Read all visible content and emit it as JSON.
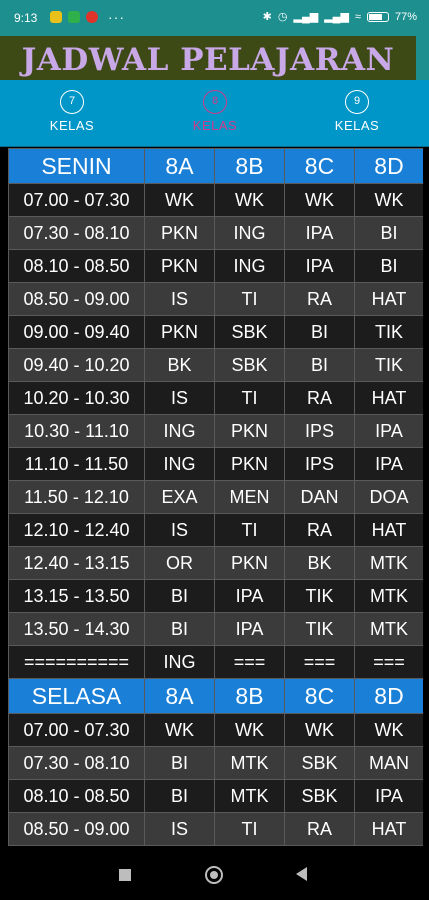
{
  "status": {
    "time": "9:13",
    "battery": "77",
    "battery_level": 0.77,
    "left_icons": [
      "notification-yellow",
      "shield-green",
      "mi-red"
    ],
    "right_icons": [
      "bluetooth-icon",
      "alarm-icon",
      "signal-icon",
      "signal-icon",
      "wifi-icon",
      "battery-icon"
    ]
  },
  "title": "JADWAL PELAJARAN",
  "tabs": [
    {
      "number": "7",
      "label": "KELAS",
      "active": false
    },
    {
      "number": "8",
      "label": "KELAS",
      "active": true
    },
    {
      "number": "9",
      "label": "KELAS",
      "active": false
    }
  ],
  "colors": {
    "accent": "#d23c8c",
    "header": "#1a7fd6",
    "tabbar": "#0096c7",
    "titlebar": "#3d4a16",
    "title_text": "#c9a8e8"
  },
  "days": [
    {
      "name": "SENIN",
      "classes": [
        "8A",
        "8B",
        "8C",
        "8D"
      ],
      "rows": [
        {
          "time": "07.00 - 07.30",
          "cells": [
            "WK",
            "WK",
            "WK",
            "WK"
          ]
        },
        {
          "time": "07.30 - 08.10",
          "cells": [
            "PKN",
            "ING",
            "IPA",
            "BI"
          ]
        },
        {
          "time": "08.10 - 08.50",
          "cells": [
            "PKN",
            "ING",
            "IPA",
            "BI"
          ]
        },
        {
          "time": "08.50 - 09.00",
          "cells": [
            "IS",
            "TI",
            "RA",
            "HAT"
          ]
        },
        {
          "time": "09.00 - 09.40",
          "cells": [
            "PKN",
            "SBK",
            "BI",
            "TIK"
          ]
        },
        {
          "time": "09.40 - 10.20",
          "cells": [
            "BK",
            "SBK",
            "BI",
            "TIK"
          ]
        },
        {
          "time": "10.20 - 10.30",
          "cells": [
            "IS",
            "TI",
            "RA",
            "HAT"
          ]
        },
        {
          "time": "10.30 - 11.10",
          "cells": [
            "ING",
            "PKN",
            "IPS",
            "IPA"
          ]
        },
        {
          "time": "11.10 - 11.50",
          "cells": [
            "ING",
            "PKN",
            "IPS",
            "IPA"
          ]
        },
        {
          "time": "11.50 - 12.10",
          "cells": [
            "EXA",
            "MEN",
            "DAN",
            "DOA"
          ]
        },
        {
          "time": "12.10 - 12.40",
          "cells": [
            "IS",
            "TI",
            "RA",
            "HAT"
          ]
        },
        {
          "time": "12.40 - 13.15",
          "cells": [
            "OR",
            "PKN",
            "BK",
            "MTK"
          ]
        },
        {
          "time": "13.15 - 13.50",
          "cells": [
            "BI",
            "IPA",
            "TIK",
            "MTK"
          ]
        },
        {
          "time": "13.50 - 14.30",
          "cells": [
            "BI",
            "IPA",
            "TIK",
            "MTK"
          ]
        },
        {
          "time": "==========",
          "cells": [
            "ING",
            "===",
            "===",
            "==="
          ]
        }
      ]
    },
    {
      "name": "SELASA",
      "classes": [
        "8A",
        "8B",
        "8C",
        "8D"
      ],
      "rows": [
        {
          "time": "07.00 - 07.30",
          "cells": [
            "WK",
            "WK",
            "WK",
            "WK"
          ]
        },
        {
          "time": "07.30 - 08.10",
          "cells": [
            "BI",
            "MTK",
            "SBK",
            "MAN"
          ]
        },
        {
          "time": "08.10 - 08.50",
          "cells": [
            "BI",
            "MTK",
            "SBK",
            "IPA"
          ]
        },
        {
          "time": "08.50 - 09.00",
          "cells": [
            "IS",
            "TI",
            "RA",
            "HAT"
          ]
        }
      ]
    }
  ]
}
